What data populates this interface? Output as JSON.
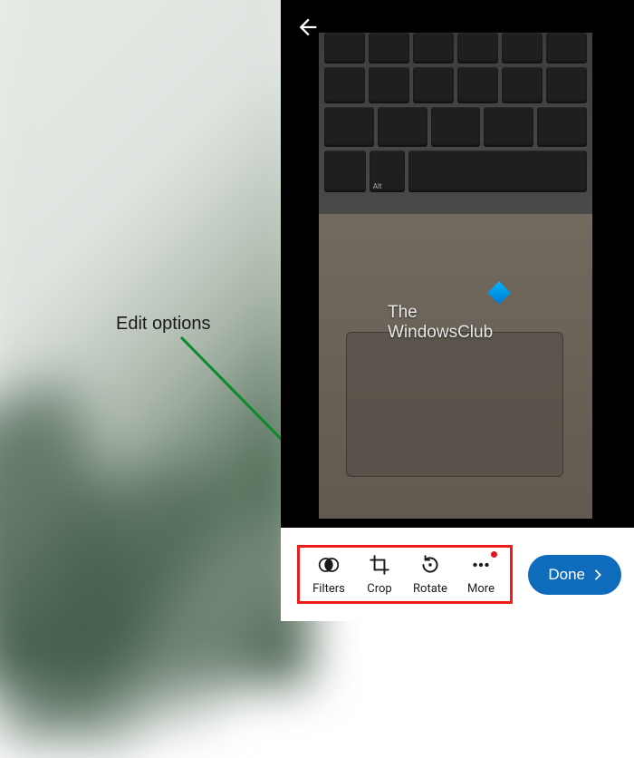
{
  "annotation": {
    "label": "Edit options"
  },
  "editor": {
    "back_label": "Back"
  },
  "watermark": {
    "line1": "The",
    "line2": "WindowsClub"
  },
  "keyboard": {
    "alt_key": "Alt"
  },
  "toolbar": {
    "items": [
      {
        "icon": "filters-icon",
        "label": "Filters"
      },
      {
        "icon": "crop-icon",
        "label": "Crop"
      },
      {
        "icon": "rotate-icon",
        "label": "Rotate"
      },
      {
        "icon": "more-icon",
        "label": "More"
      }
    ],
    "done_label": "Done"
  },
  "colors": {
    "accent": "#0f6cbd",
    "highlight_box": "#ef1c1c",
    "notification_dot": "#e81123",
    "annotation_arrow": "#0a8a2a"
  }
}
